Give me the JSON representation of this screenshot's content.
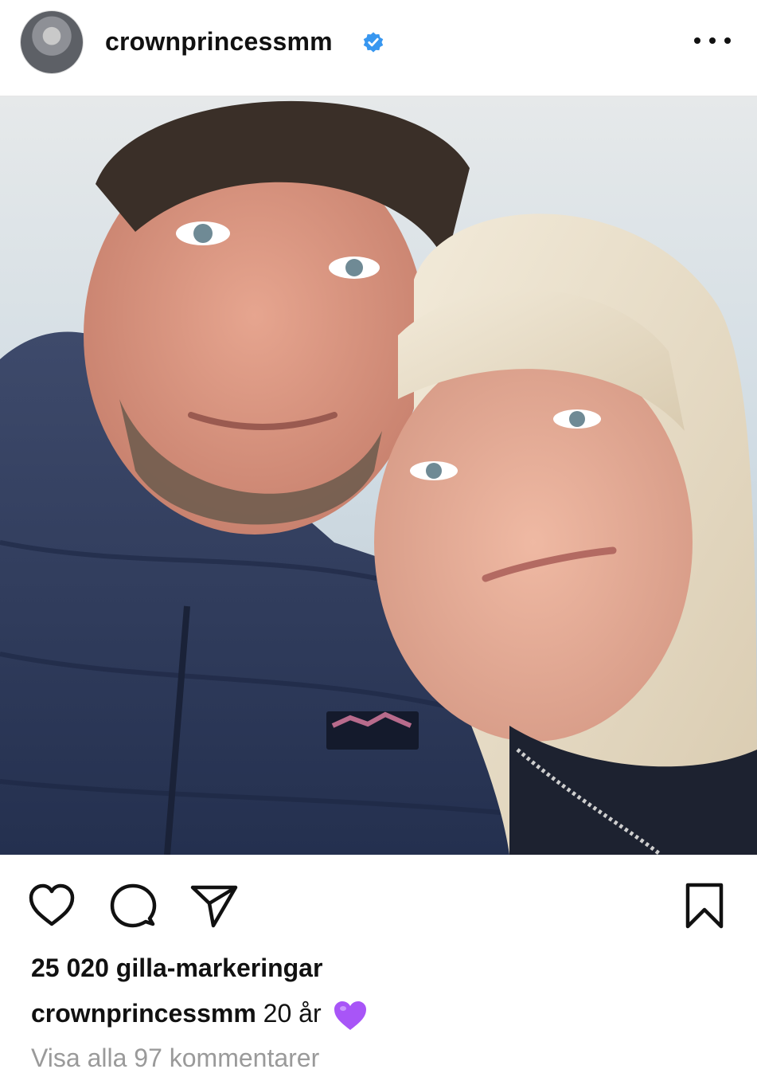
{
  "header": {
    "username": "crownprincessmm",
    "verified": true
  },
  "post": {
    "image_description_icons": [
      "photo"
    ],
    "likes_text": "25 020 gilla-markeringar",
    "caption": {
      "username": "crownprincessmm",
      "text": "20 år",
      "emoji": "purple-heart"
    },
    "comments_link": "Visa alla 97 kommentarer"
  },
  "colors": {
    "verified_blue": "#3897f0",
    "purple_heart": "#a855f7"
  }
}
